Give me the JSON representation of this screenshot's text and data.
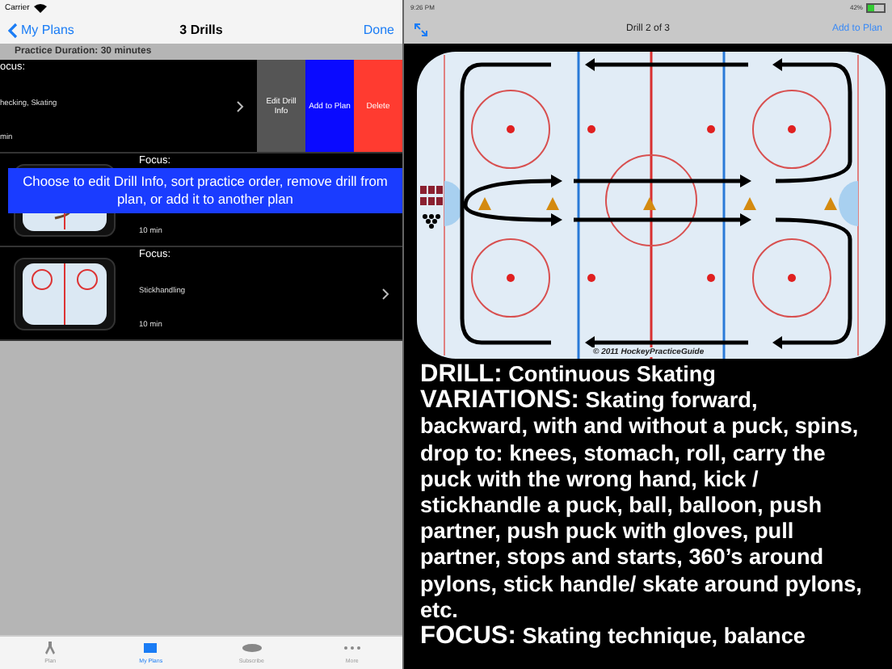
{
  "left_status_bar": {
    "carrier": "Carrier"
  },
  "left_nav": {
    "back": "My Plans",
    "title": "3 Drills",
    "done": "Done"
  },
  "duration": "Practice Duration: 30 minutes",
  "drills": [
    {
      "swiped": true,
      "focus_label": "ocus:",
      "focus": "hecking, Skating",
      "duration": "min"
    },
    {
      "swiped": false,
      "focus_label": "Focus:",
      "duration": "10 min"
    },
    {
      "swiped": false,
      "focus_label": "Focus:",
      "focus": "Stickhandling",
      "duration": "10 min"
    }
  ],
  "swipe_actions": [
    {
      "kind": "edit",
      "label": "Edit Drill Info"
    },
    {
      "kind": "add",
      "label": "Add to Plan"
    },
    {
      "kind": "delete",
      "label": "Delete"
    }
  ],
  "hint_banner": "Choose to edit Drill Info, sort practice order, remove drill from plan, or add it to another plan",
  "tab_bar": [
    {
      "label": "Plan",
      "selected": false
    },
    {
      "label": "My Plans",
      "selected": true
    },
    {
      "label": "Subscribe",
      "selected": false
    },
    {
      "label": "More",
      "selected": false
    }
  ],
  "right_status_bar": {
    "time": "9:26 PM",
    "battery": "42%"
  },
  "right_nav": {
    "title": "Drill 2 of 3",
    "action": "Add to Plan"
  },
  "diagram": {
    "copyright": "© 2011 HockeyPracticeGuide"
  },
  "details": [
    {
      "label": "DRILL:",
      "text": "Continuous Skating"
    },
    {
      "label": "VARIATIONS:",
      "text": "Skating forward, backward, with and without a puck, spins, drop to: knees, stomach, roll, carry the puck with the wrong hand, kick / stickhandle a puck, ball, balloon, push partner, push puck with gloves, pull partner, stops and starts, 360’s around pylons, stick handle/ skate around pylons, etc."
    },
    {
      "label": "FOCUS:",
      "text": "Skating technique, balance"
    }
  ]
}
